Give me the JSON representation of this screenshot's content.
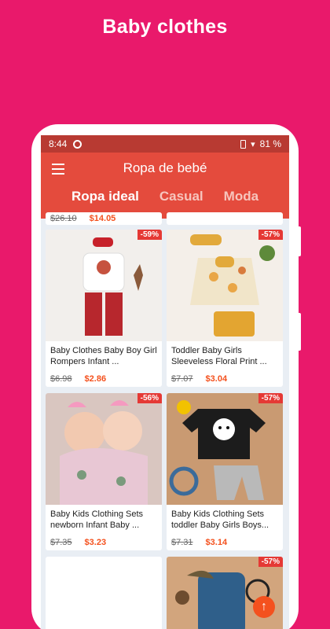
{
  "promo": {
    "title": "Baby clothes"
  },
  "status": {
    "time": "8:44",
    "battery": "81 %"
  },
  "appbar": {
    "title": "Ropa de bebé"
  },
  "tabs": [
    {
      "label": "Ropa ideal",
      "active": true
    },
    {
      "label": "Casual",
      "active": false
    },
    {
      "label": "Moda",
      "active": false
    }
  ],
  "partial_top": {
    "old": "$26.10",
    "new": "$14.05"
  },
  "products": [
    {
      "title": "Baby Clothes Baby Boy Girl Rompers Infant ...",
      "old": "$6.98",
      "new": "$2.86",
      "discount": "-59%"
    },
    {
      "title": "Toddler Baby Girls Sleeveless Floral Print ...",
      "old": "$7.07",
      "new": "$3.04",
      "discount": "-57%"
    },
    {
      "title": "Baby Kids Clothing Sets newborn Infant Baby ...",
      "old": "$7.35",
      "new": "$3.23",
      "discount": "-56%"
    },
    {
      "title": "Baby Kids Clothing Sets toddler Baby Girls Boys...",
      "old": "$7.31",
      "new": "$3.14",
      "discount": "-57%"
    }
  ],
  "bottom_right": {
    "discount": "-57%"
  },
  "icons": {
    "menu": "hamburger-icon",
    "fab": "arrow-up-icon",
    "sync": "sync-icon",
    "battery": "battery-icon",
    "wifi": "wifi-icon"
  },
  "colors": {
    "background": "#e9196b",
    "appbar": "#e44b3d",
    "statusbar": "#b83a32",
    "price": "#f4511e",
    "discount": "#e53935"
  }
}
